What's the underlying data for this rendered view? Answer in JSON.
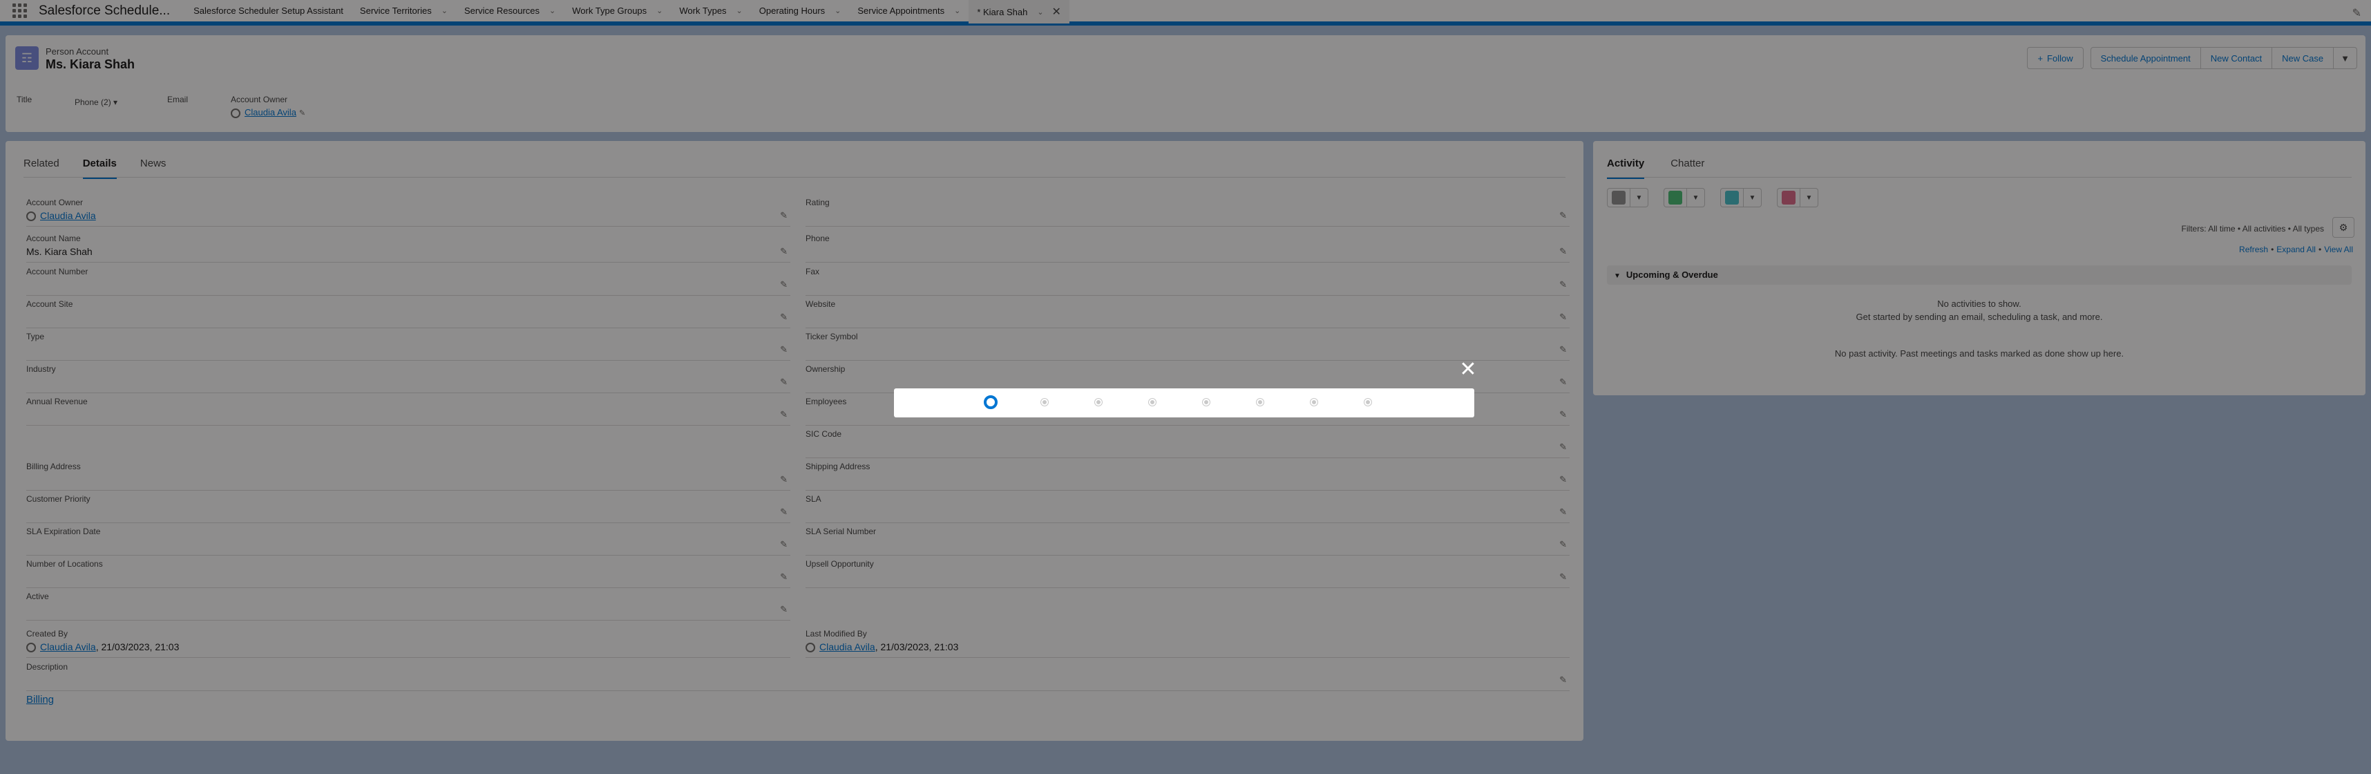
{
  "app": {
    "name": "Salesforce Schedule..."
  },
  "nav": {
    "tabs": [
      {
        "label": "Salesforce Scheduler Setup Assistant"
      },
      {
        "label": "Service Territories"
      },
      {
        "label": "Service Resources"
      },
      {
        "label": "Work Type Groups"
      },
      {
        "label": "Work Types"
      },
      {
        "label": "Operating Hours"
      },
      {
        "label": "Service Appointments"
      },
      {
        "label": "* Kiara Shah"
      }
    ]
  },
  "record": {
    "type": "Person Account",
    "name": "Ms. Kiara Shah",
    "actions": {
      "follow": "Follow",
      "schedule": "Schedule Appointment",
      "new_contact": "New Contact",
      "new_case": "New Case"
    },
    "highlights": {
      "title_label": "Title",
      "phone_label": "Phone (2)",
      "email_label": "Email",
      "owner_label": "Account Owner",
      "owner_value": "Claudia Avila"
    }
  },
  "details": {
    "tabs": [
      "Related",
      "Details",
      "News"
    ],
    "left": [
      {
        "label": "Account Owner",
        "value": "Claudia Avila"
      },
      {
        "label": "Account Name",
        "value": "Ms. Kiara Shah"
      },
      {
        "label": "Account Number",
        "value": ""
      },
      {
        "label": "Account Site",
        "value": ""
      },
      {
        "label": "Type",
        "value": ""
      },
      {
        "label": "Industry",
        "value": ""
      },
      {
        "label": "Annual Revenue",
        "value": ""
      },
      {
        "label": "",
        "value": ""
      },
      {
        "label": "Billing Address",
        "value": ""
      },
      {
        "label": "Customer Priority",
        "value": ""
      },
      {
        "label": "SLA Expiration Date",
        "value": ""
      },
      {
        "label": "Number of Locations",
        "value": ""
      },
      {
        "label": "Active",
        "value": ""
      },
      {
        "label": "Created By",
        "value": "Claudia Avila",
        "suffix": ", 21/03/2023, 21:03"
      },
      {
        "label": "Description",
        "value": ""
      }
    ],
    "right": [
      {
        "label": "Rating",
        "value": ""
      },
      {
        "label": "Phone",
        "value": ""
      },
      {
        "label": "Fax",
        "value": ""
      },
      {
        "label": "Website",
        "value": ""
      },
      {
        "label": "Ticker Symbol",
        "value": ""
      },
      {
        "label": "Ownership",
        "value": ""
      },
      {
        "label": "Employees",
        "value": ""
      },
      {
        "label": "SIC Code",
        "value": ""
      },
      {
        "label": "Shipping Address",
        "value": ""
      },
      {
        "label": "SLA",
        "value": ""
      },
      {
        "label": "SLA Serial Number",
        "value": ""
      },
      {
        "label": "Upsell Opportunity",
        "value": ""
      },
      {
        "label": "Last Modified By",
        "value": "Claudia Avila",
        "suffix": ", 21/03/2023, 21:03"
      }
    ],
    "section_link": "Billing"
  },
  "activity": {
    "tabs": [
      "Activity",
      "Chatter"
    ],
    "button_colors": [
      "#939393",
      "#4bc076",
      "#48c3cc",
      "#e06b8b"
    ],
    "filters": "Filters: All time • All activities • All types",
    "links": {
      "refresh": "Refresh",
      "expand": "Expand All",
      "view": "View All"
    },
    "upcoming_title": "Upcoming & Overdue",
    "no_activities": "No activities to show.",
    "get_started": "Get started by sending an email, scheduling a task, and more.",
    "no_past": "No past activity. Past meetings and tasks marked as done show up here."
  },
  "modal": {
    "steps": 8,
    "active_step": 1
  }
}
